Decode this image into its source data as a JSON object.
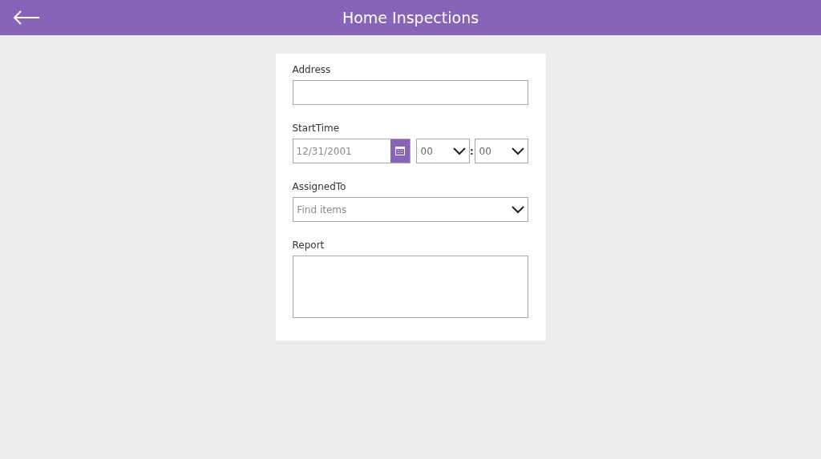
{
  "header": {
    "title": "Home Inspections"
  },
  "fields": [
    {
      "kind": "text",
      "label": "Address"
    },
    {
      "kind": "datetime",
      "label": "StartTime",
      "placeholder": "12/31/2001",
      "hour": "00",
      "separator": ":",
      "minute": "00"
    },
    {
      "kind": "combobox",
      "label": "AssignedTo",
      "placeholder": "Find items"
    },
    {
      "kind": "multiline",
      "label": "Report"
    }
  ]
}
